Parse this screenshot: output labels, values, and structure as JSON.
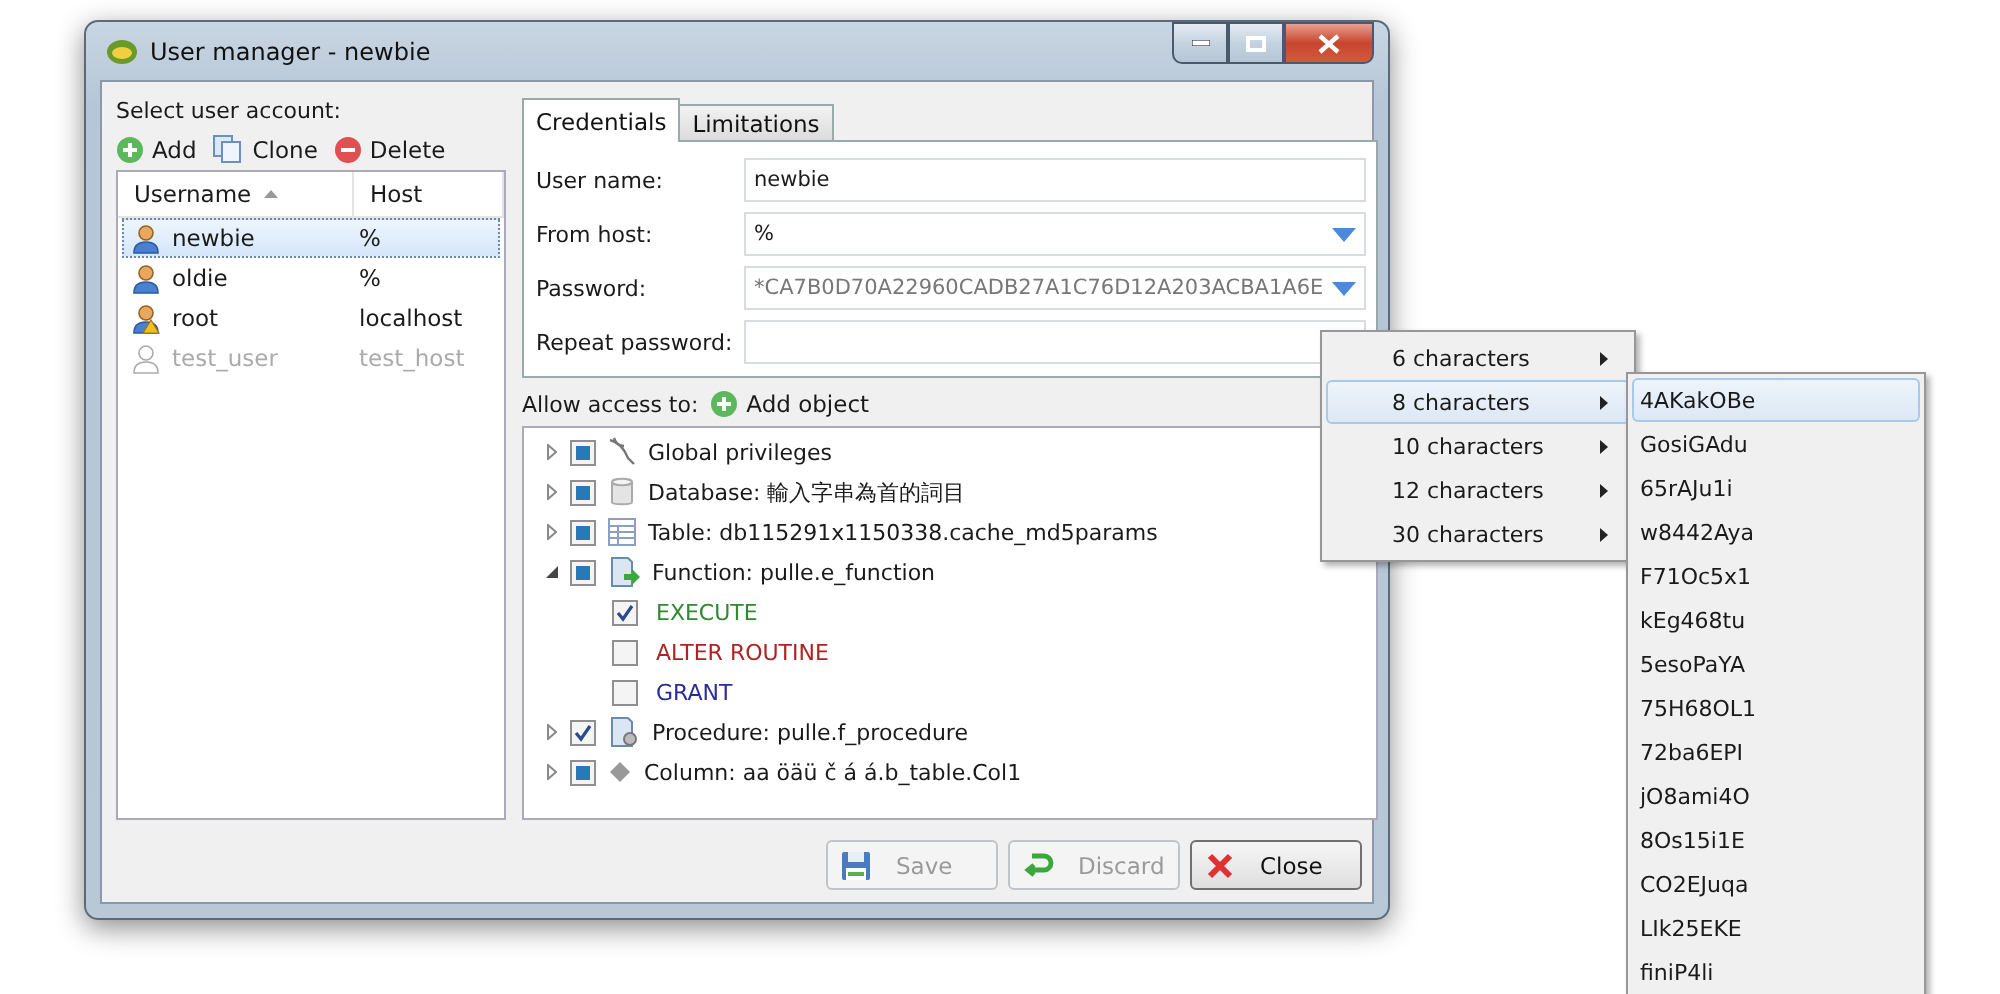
{
  "window": {
    "title": "User manager - newbie"
  },
  "accounts": {
    "label": "Select user account:",
    "actions": [
      {
        "kind": "add",
        "label": "Add"
      },
      {
        "kind": "clone",
        "label": "Clone"
      },
      {
        "kind": "delete",
        "label": "Delete"
      }
    ],
    "columns": [
      {
        "label": "Username",
        "sorted": true
      },
      {
        "label": "Host",
        "sorted": false
      }
    ],
    "rows": [
      {
        "username": "newbie",
        "host": "%",
        "selected": true,
        "disabled": false,
        "kind": "user"
      },
      {
        "username": "oldie",
        "host": "%",
        "selected": false,
        "disabled": false,
        "kind": "user"
      },
      {
        "username": "root",
        "host": "localhost",
        "selected": false,
        "disabled": false,
        "kind": "admin"
      },
      {
        "username": "test_user",
        "host": "test_host",
        "selected": false,
        "disabled": true,
        "kind": "user"
      }
    ]
  },
  "tabs": [
    {
      "label": "Credentials",
      "selected": true
    },
    {
      "label": "Limitations",
      "selected": false
    }
  ],
  "fields": [
    {
      "label": "User name:",
      "value": "newbie",
      "kind": "text"
    },
    {
      "label": "From host:",
      "value": "%",
      "kind": "combo"
    },
    {
      "label": "Password:",
      "value": "*CA7B0D70A22960CADB27A1C76D12A203ACBA1A6E",
      "kind": "combo"
    },
    {
      "label": "Repeat password:",
      "kind": "text"
    }
  ],
  "access": {
    "label": "Allow access to:",
    "add_label": "Add object"
  },
  "tree": [
    {
      "label": "Global privileges",
      "kind": "global",
      "checked": false,
      "partial": true,
      "expanded": false
    },
    {
      "label": "Database: 輸入字串為首的詞目",
      "kind": "database",
      "checked": false,
      "partial": true,
      "expanded": false
    },
    {
      "label": "Table: db115291x1150338.cache_md5params",
      "kind": "table",
      "checked": false,
      "partial": true,
      "expanded": false
    },
    {
      "label": "Function: pulle.e_function",
      "kind": "function",
      "checked": false,
      "partial": true,
      "expanded": true,
      "children": [
        {
          "label": "EXECUTE",
          "checked": true,
          "color": "#2e8b2e"
        },
        {
          "label": "ALTER ROUTINE",
          "checked": false,
          "color": "#b22222"
        },
        {
          "label": "GRANT",
          "checked": false,
          "color": "#2a2a9a"
        }
      ]
    },
    {
      "label": "Procedure: pulle.f_procedure",
      "kind": "procedure",
      "checked": true,
      "partial": false,
      "expanded": false
    },
    {
      "label": "Column: aa öäü č á á.b_table.Col1",
      "kind": "column",
      "checked": false,
      "partial": true,
      "expanded": false
    }
  ],
  "buttons": [
    {
      "kind": "save",
      "label": "Save",
      "disabled": true
    },
    {
      "kind": "discard",
      "label": "Discard",
      "disabled": true
    },
    {
      "kind": "close",
      "label": "Close",
      "disabled": false
    }
  ],
  "menu": [
    {
      "label": "6 characters",
      "selected": false
    },
    {
      "label": "8 characters",
      "selected": true
    },
    {
      "label": "10 characters",
      "selected": false
    },
    {
      "label": "12 characters",
      "selected": false
    },
    {
      "label": "30 characters",
      "selected": false
    }
  ],
  "submenu": [
    {
      "label": "4AKakOBe",
      "selected": true
    },
    {
      "label": "GosiGAdu",
      "selected": false
    },
    {
      "label": "65rAJu1i",
      "selected": false
    },
    {
      "label": "w8442Aya",
      "selected": false
    },
    {
      "label": "F71Oc5x1",
      "selected": false
    },
    {
      "label": "kEg468tu",
      "selected": false
    },
    {
      "label": "5esoPaYA",
      "selected": false
    },
    {
      "label": "75H68OL1",
      "selected": false
    },
    {
      "label": "72ba6EPI",
      "selected": false
    },
    {
      "label": "jO8ami4O",
      "selected": false
    },
    {
      "label": "8Os15i1E",
      "selected": false
    },
    {
      "label": "CO2EJuqa",
      "selected": false
    },
    {
      "label": "LIk25EKE",
      "selected": false
    },
    {
      "label": "finiP4li",
      "selected": false
    }
  ]
}
